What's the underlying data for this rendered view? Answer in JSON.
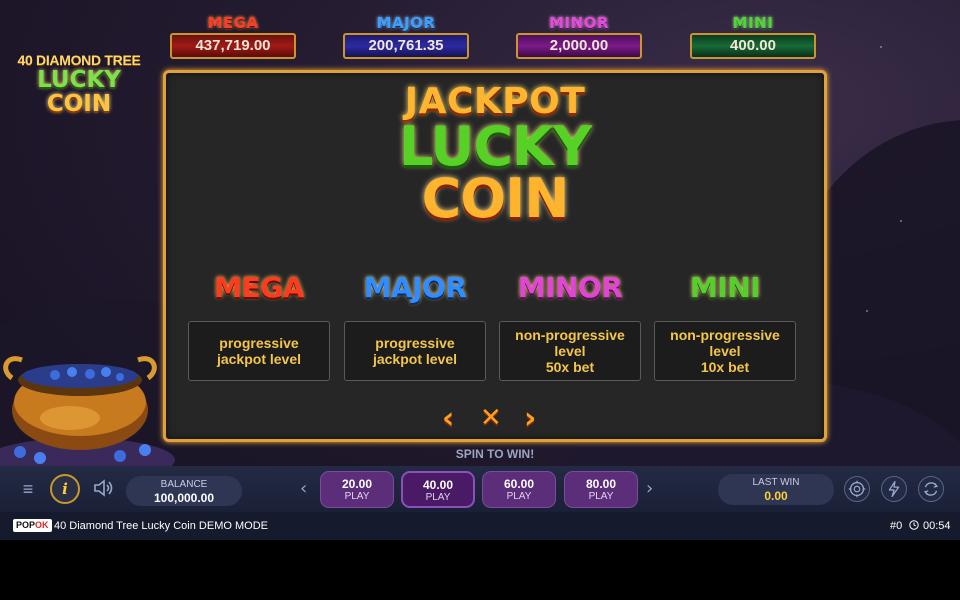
{
  "jackpots": [
    {
      "name": "MEGA",
      "value": "437,719.00"
    },
    {
      "name": "MAJOR",
      "value": "200,761.35"
    },
    {
      "name": "MINOR",
      "value": "2,000.00"
    },
    {
      "name": "MINI",
      "value": "400.00"
    }
  ],
  "logo": {
    "line1": "40 DIAMOND TREE",
    "line2": "LUCKY",
    "line3": "COIN"
  },
  "panel": {
    "title1": "JACKPOT",
    "title2": "LUCKY",
    "title3": "COIN",
    "tiers": [
      {
        "name": "MEGA",
        "lines": [
          "progressive",
          "jackpot level"
        ]
      },
      {
        "name": "MAJOR",
        "lines": [
          "progressive",
          "jackpot level"
        ]
      },
      {
        "name": "MINOR",
        "lines": [
          "non-progressive",
          "level",
          "50x bet"
        ]
      },
      {
        "name": "MINI",
        "lines": [
          "non-progressive",
          "level",
          "10x bet"
        ]
      }
    ],
    "nav": {
      "prev": "‹",
      "close": "✕",
      "next": "›"
    }
  },
  "spin_text": "SPIN TO WIN!",
  "controls": {
    "menu_icon": "≡",
    "info_icon": "i",
    "balance": {
      "label": "BALANCE",
      "value": "100,000.00"
    },
    "prev_arrow": "‹",
    "next_arrow": "›",
    "bets": [
      {
        "value": "20.00",
        "label": "PLAY"
      },
      {
        "value": "40.00",
        "label": "PLAY"
      },
      {
        "value": "60.00",
        "label": "PLAY"
      },
      {
        "value": "80.00",
        "label": "PLAY"
      }
    ],
    "last_win": {
      "label": "LAST WIN",
      "value": "0.00"
    }
  },
  "footer": {
    "brand_a": "POP",
    "brand_b": "OK",
    "game_name": "40 Diamond Tree Lucky Coin",
    "mode": "DEMO MODE",
    "round": "#0",
    "clock": "00:54"
  }
}
